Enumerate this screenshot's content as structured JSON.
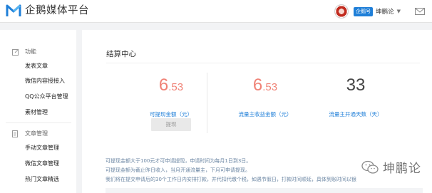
{
  "brand": {
    "name": "企鹅媒体平台",
    "color": "#1f7fd8"
  },
  "header": {
    "badge": "企鹅号",
    "user_name": "坤鹏论",
    "caret": "▼",
    "mail_icon": "mail-icon"
  },
  "sidebar": {
    "groups": [
      {
        "label": "功能",
        "icon": "edit-icon",
        "items": [
          "发表文章",
          "微信内容授接入",
          "QQ公众平台管理",
          "素材管理"
        ]
      },
      {
        "label": "文章管理",
        "icon": "document-icon",
        "items": [
          "手动文章管理",
          "微信文章管理",
          "热门文章精选"
        ]
      }
    ]
  },
  "main": {
    "title": "结算中心",
    "stats": [
      {
        "int": "6",
        "dec": ".53",
        "label": "可提现金额（元）",
        "color": "#f08276"
      },
      {
        "int": "6",
        "dec": ".53",
        "label": "流量主收益金额（元）",
        "color": "#f08276"
      },
      {
        "int": "33",
        "dec": "",
        "label": "流量主开通天数（天）",
        "color": "#444444"
      }
    ],
    "withdraw_button": "提现",
    "notes": [
      "可提现金额大于100元才可申请提现，申请时间为每月1日到3日。",
      "可提现金额为截止昨日收入，当月开通流量主，下月可申请提现。",
      "我们将在提交申请后的30个工作日内安排打款，并代扣代缴个税，如遇节假日，打款时间顺延，具体到账时间以银"
    ]
  },
  "watermark": {
    "text": "坤鹏论"
  }
}
